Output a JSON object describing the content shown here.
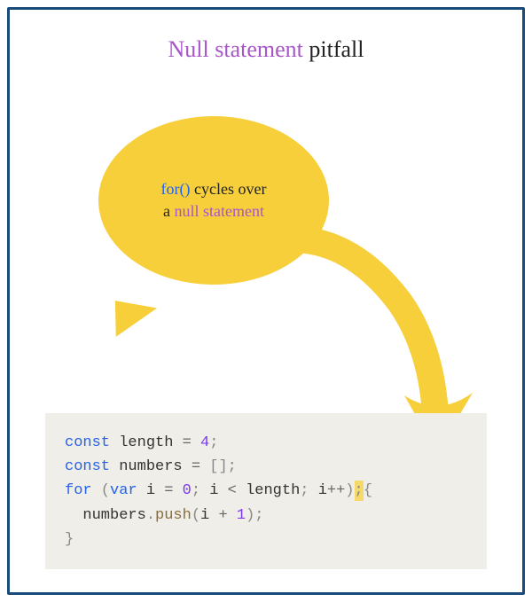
{
  "title": {
    "accent": "Null statement",
    "plain": " pitfall"
  },
  "bubble": {
    "prefix": "for()",
    "mid1": " cycles over",
    "mid2": "a ",
    "suffix": "null statement"
  },
  "code": {
    "l1_kw": "const",
    "l1_id": " length ",
    "l1_eq": "= ",
    "l1_num": "4",
    "l1_semi": ";",
    "l2_kw": "const",
    "l2_id": " numbers ",
    "l2_eq": "= ",
    "l2_arr": "[]",
    "l2_semi": ";",
    "l3_for": "for",
    "l3_open": " (",
    "l3_var": "var",
    "l3_i": " i ",
    "l3_eq": "= ",
    "l3_zero": "0",
    "l3_s1": "; ",
    "l3_i2": "i ",
    "l3_lt": "< ",
    "l3_len": "length",
    "l3_s2": "; ",
    "l3_i3": "i",
    "l3_pp": "++",
    "l3_close": ")",
    "l3_hl": ";",
    "l3_brace": "{",
    "l4_ind": "  ",
    "l4_nums": "numbers",
    "l4_dot": ".",
    "l4_push": "push",
    "l4_open": "(",
    "l4_i": "i ",
    "l4_plus": "+ ",
    "l4_one": "1",
    "l4_close": ")",
    "l4_semi": ";",
    "l5_brace": "}"
  }
}
